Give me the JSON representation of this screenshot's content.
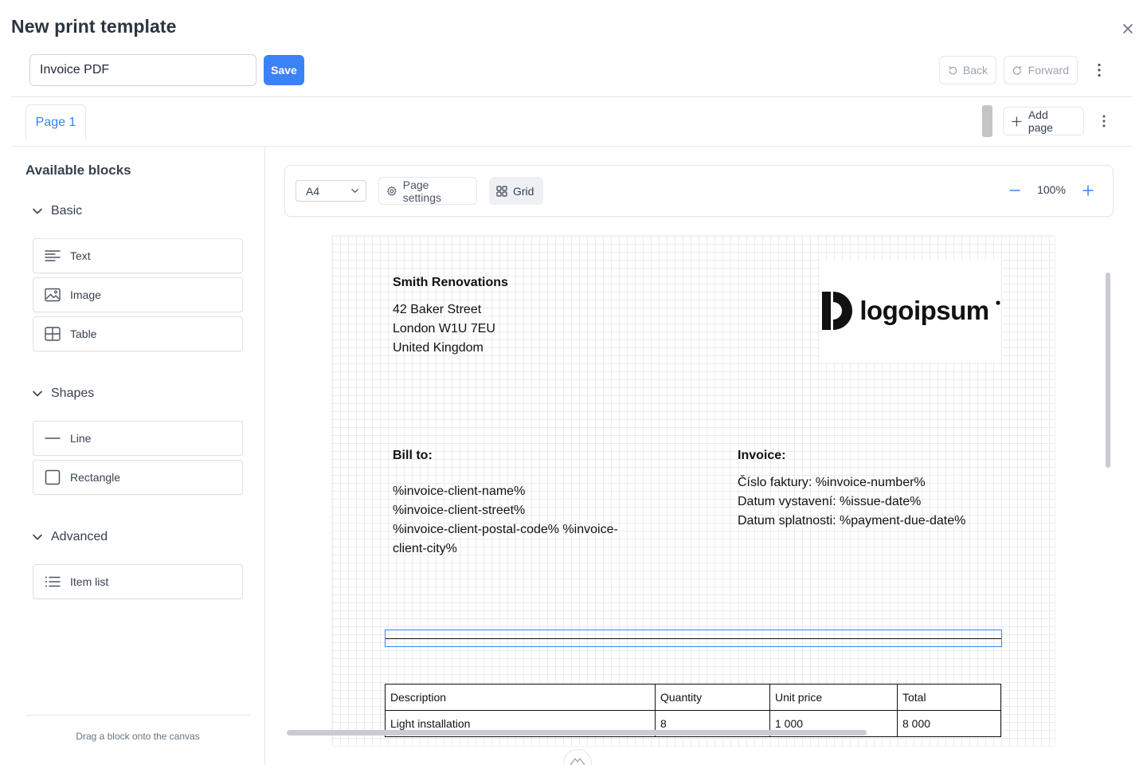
{
  "dialog": {
    "title": "New print template"
  },
  "header": {
    "template_name": "Invoice PDF",
    "save_label": "Save",
    "back_label": "Back",
    "forward_label": "Forward"
  },
  "pages": {
    "tabs": [
      {
        "label": "Page 1",
        "active": true
      }
    ],
    "add_page_label": "Add page"
  },
  "sidebar": {
    "title": "Available blocks",
    "groups": [
      {
        "label": "Basic",
        "items": [
          {
            "label": "Text",
            "icon": "text-lines-icon"
          },
          {
            "label": "Image",
            "icon": "image-icon"
          },
          {
            "label": "Table",
            "icon": "table-icon"
          }
        ]
      },
      {
        "label": "Shapes",
        "items": [
          {
            "label": "Line",
            "icon": "line-icon"
          },
          {
            "label": "Rectangle",
            "icon": "rectangle-icon"
          }
        ]
      },
      {
        "label": "Advanced",
        "items": [
          {
            "label": "Item list",
            "icon": "list-icon"
          }
        ]
      }
    ],
    "hint": "Drag a block onto the canvas"
  },
  "toolbar": {
    "paper_size": "A4",
    "page_settings_label": "Page settings",
    "grid_label": "Grid",
    "grid_active": true,
    "zoom": "100%"
  },
  "document": {
    "company": {
      "name": "Smith Renovations",
      "lines": [
        "42 Baker Street",
        "London W1U 7EU",
        "United Kingdom"
      ]
    },
    "logo_text": "logoipsum",
    "bill_to": {
      "label": "Bill to:",
      "lines": [
        "%invoice-client-name%",
        "%invoice-client-street%",
        "%invoice-client-postal-code% %invoice-",
        "client-city%"
      ]
    },
    "invoice": {
      "label": "Invoice:",
      "lines": [
        "Číslo faktury: %invoice-number%",
        "Datum vystavení: %issue-date%",
        "Datum splatnosti: %payment-due-date%"
      ]
    },
    "table": {
      "headers": [
        "Description",
        "Quantity",
        "Unit price",
        "Total"
      ],
      "rows": [
        [
          "Light installation",
          "8",
          "1 000",
          "8 000"
        ]
      ]
    }
  },
  "colors": {
    "accent": "#3b82f6",
    "border": "#e5e7eb",
    "text": "#374151"
  }
}
